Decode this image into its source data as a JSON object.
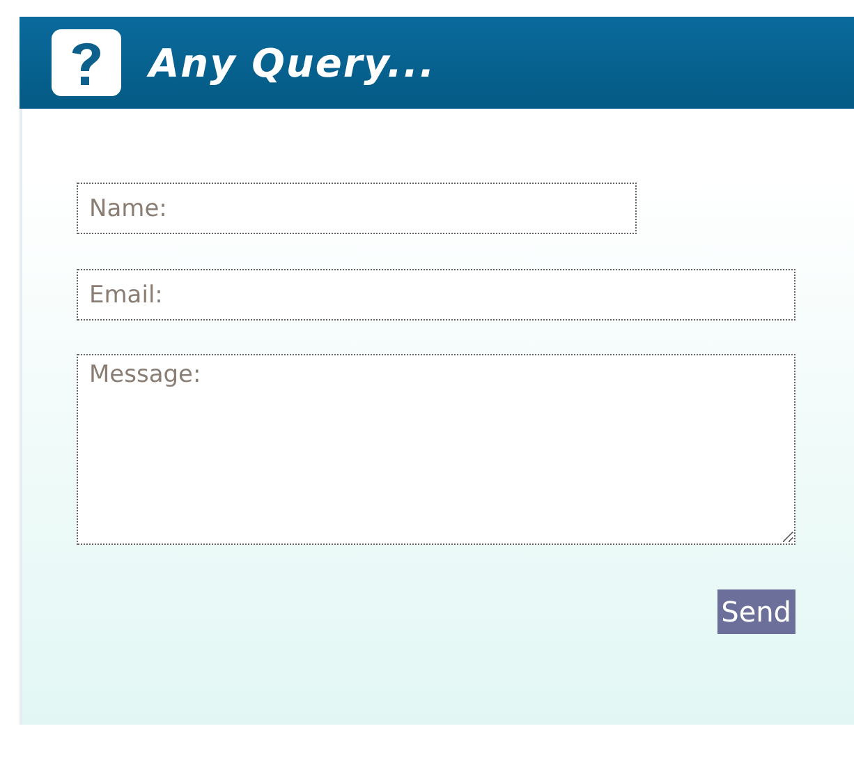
{
  "header": {
    "title": "Any Query..."
  },
  "form": {
    "name": {
      "placeholder": "Name:"
    },
    "email": {
      "placeholder": "Email:"
    },
    "message": {
      "placeholder": "Message:"
    },
    "submit": "Send"
  }
}
